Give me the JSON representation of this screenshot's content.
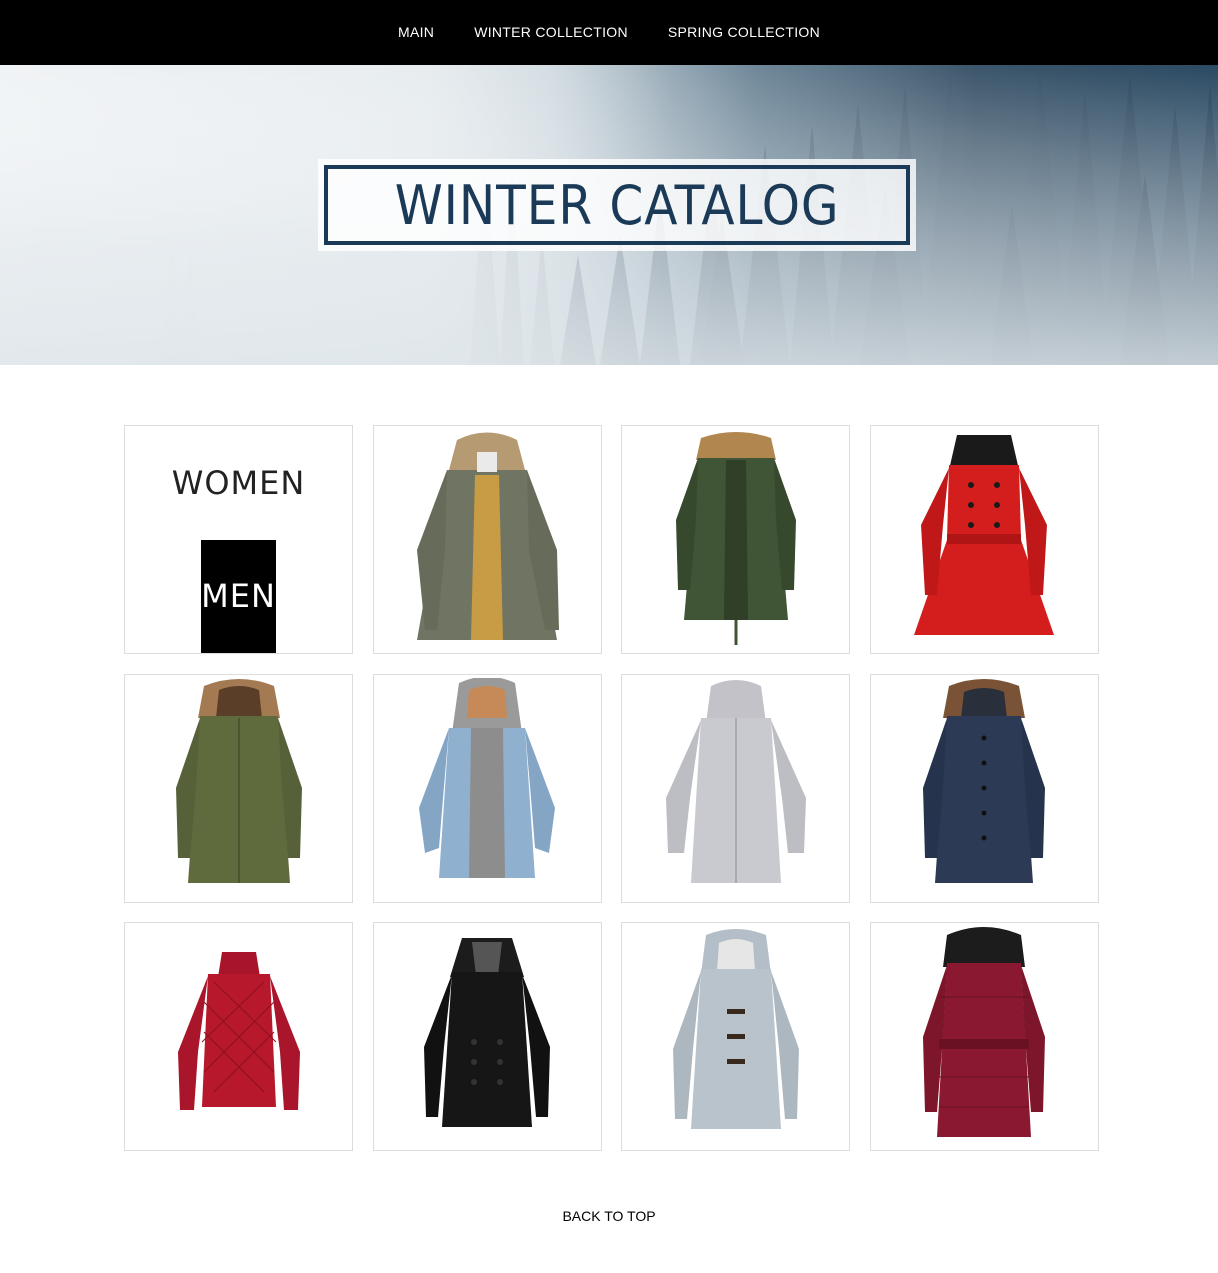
{
  "nav": {
    "items": [
      {
        "label": "MAIN"
      },
      {
        "label": "WINTER COLLECTION"
      },
      {
        "label": "SPRING COLLECTION"
      }
    ]
  },
  "hero": {
    "title": "WINTER CATALOG"
  },
  "categories": {
    "women": "WOMEN",
    "men": "MEN"
  },
  "products": [
    {
      "icon": "olive-parka-fur-hood-icon",
      "color": "#6f7562"
    },
    {
      "icon": "green-parka-fur-hood-icon",
      "color": "#3f5535"
    },
    {
      "icon": "red-double-breasted-coat-icon",
      "color": "#d41e1e"
    },
    {
      "icon": "olive-hooded-parka-icon",
      "color": "#5f6b3c"
    },
    {
      "icon": "denim-hooded-jacket-icon",
      "color": "#8fb0cf"
    },
    {
      "icon": "light-grey-rain-jacket-icon",
      "color": "#c9c9d0"
    },
    {
      "icon": "navy-hooded-parka-icon",
      "color": "#2c3a55"
    },
    {
      "icon": "red-quilted-puffer-jacket-icon",
      "color": "#b8182b"
    },
    {
      "icon": "black-peacoat-icon",
      "color": "#161616"
    },
    {
      "icon": "grey-toggle-duffle-coat-icon",
      "color": "#b9c3cc"
    },
    {
      "icon": "burgundy-puffer-coat-icon",
      "color": "#8a1830"
    }
  ],
  "footer": {
    "back_to_top": "BACK TO TOP"
  }
}
